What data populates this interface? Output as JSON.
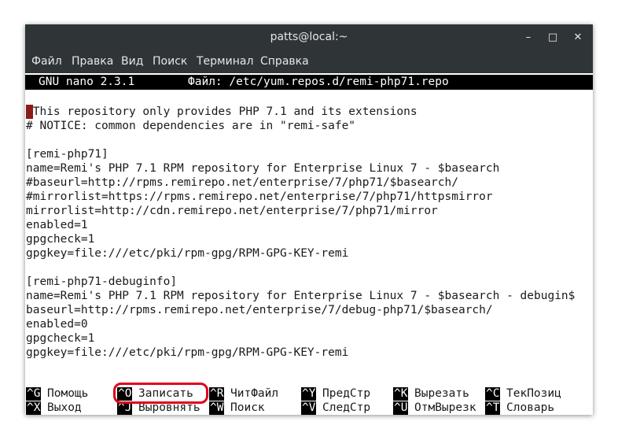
{
  "window": {
    "title": "patts@local:~",
    "minimize_glyph": "–",
    "maximize_glyph": "□",
    "close_glyph": "✕"
  },
  "menubar": [
    "Файл",
    "Правка",
    "Вид",
    "Поиск",
    "Терминал",
    "Справка"
  ],
  "nano": {
    "version": "GNU nano 2.3.1",
    "file_label": "Файл: /etc/yum.repos.d/remi-php71.repo"
  },
  "content_lines": [
    " This repository only provides PHP 7.1 and its extensions",
    "# NOTICE: common dependencies are in \"remi-safe\"",
    "",
    "[remi-php71]",
    "name=Remi's PHP 7.1 RPM repository for Enterprise Linux 7 - $basearch",
    "#baseurl=http://rpms.remirepo.net/enterprise/7/php71/$basearch/",
    "#mirrorlist=https://rpms.remirepo.net/enterprise/7/php71/httpsmirror",
    "mirrorlist=http://cdn.remirepo.net/enterprise/7/php71/mirror",
    "enabled=1",
    "gpgcheck=1",
    "gpgkey=file:///etc/pki/rpm-gpg/RPM-GPG-KEY-remi",
    "",
    "[remi-php71-debuginfo]",
    "name=Remi's PHP 7.1 RPM repository for Enterprise Linux 7 - $basearch - debugin$",
    "baseurl=http://rpms.remirepo.net/enterprise/7/debug-php71/$basearch/",
    "enabled=0",
    "gpgcheck=1",
    "gpgkey=file:///etc/pki/rpm-gpg/RPM-GPG-KEY-remi"
  ],
  "shortcuts_row1": [
    {
      "key": "^G",
      "label": "Помощь"
    },
    {
      "key": "^O",
      "label": "Записать"
    },
    {
      "key": "^R",
      "label": "ЧитФайл"
    },
    {
      "key": "^Y",
      "label": "ПредСтр"
    },
    {
      "key": "^K",
      "label": "Вырезать"
    },
    {
      "key": "^C",
      "label": "ТекПозиц"
    }
  ],
  "shortcuts_row2": [
    {
      "key": "^X",
      "label": "Выход"
    },
    {
      "key": "^J",
      "label": "Выровнять"
    },
    {
      "key": "^W",
      "label": "Поиск"
    },
    {
      "key": "^V",
      "label": "СледСтр"
    },
    {
      "key": "^U",
      "label": "ОтмВырезк"
    },
    {
      "key": "^T",
      "label": "Словарь"
    }
  ],
  "colors": {
    "titlebar": "#2f3437",
    "cursor": "#8b1a1a",
    "highlight": "#e0001b"
  }
}
